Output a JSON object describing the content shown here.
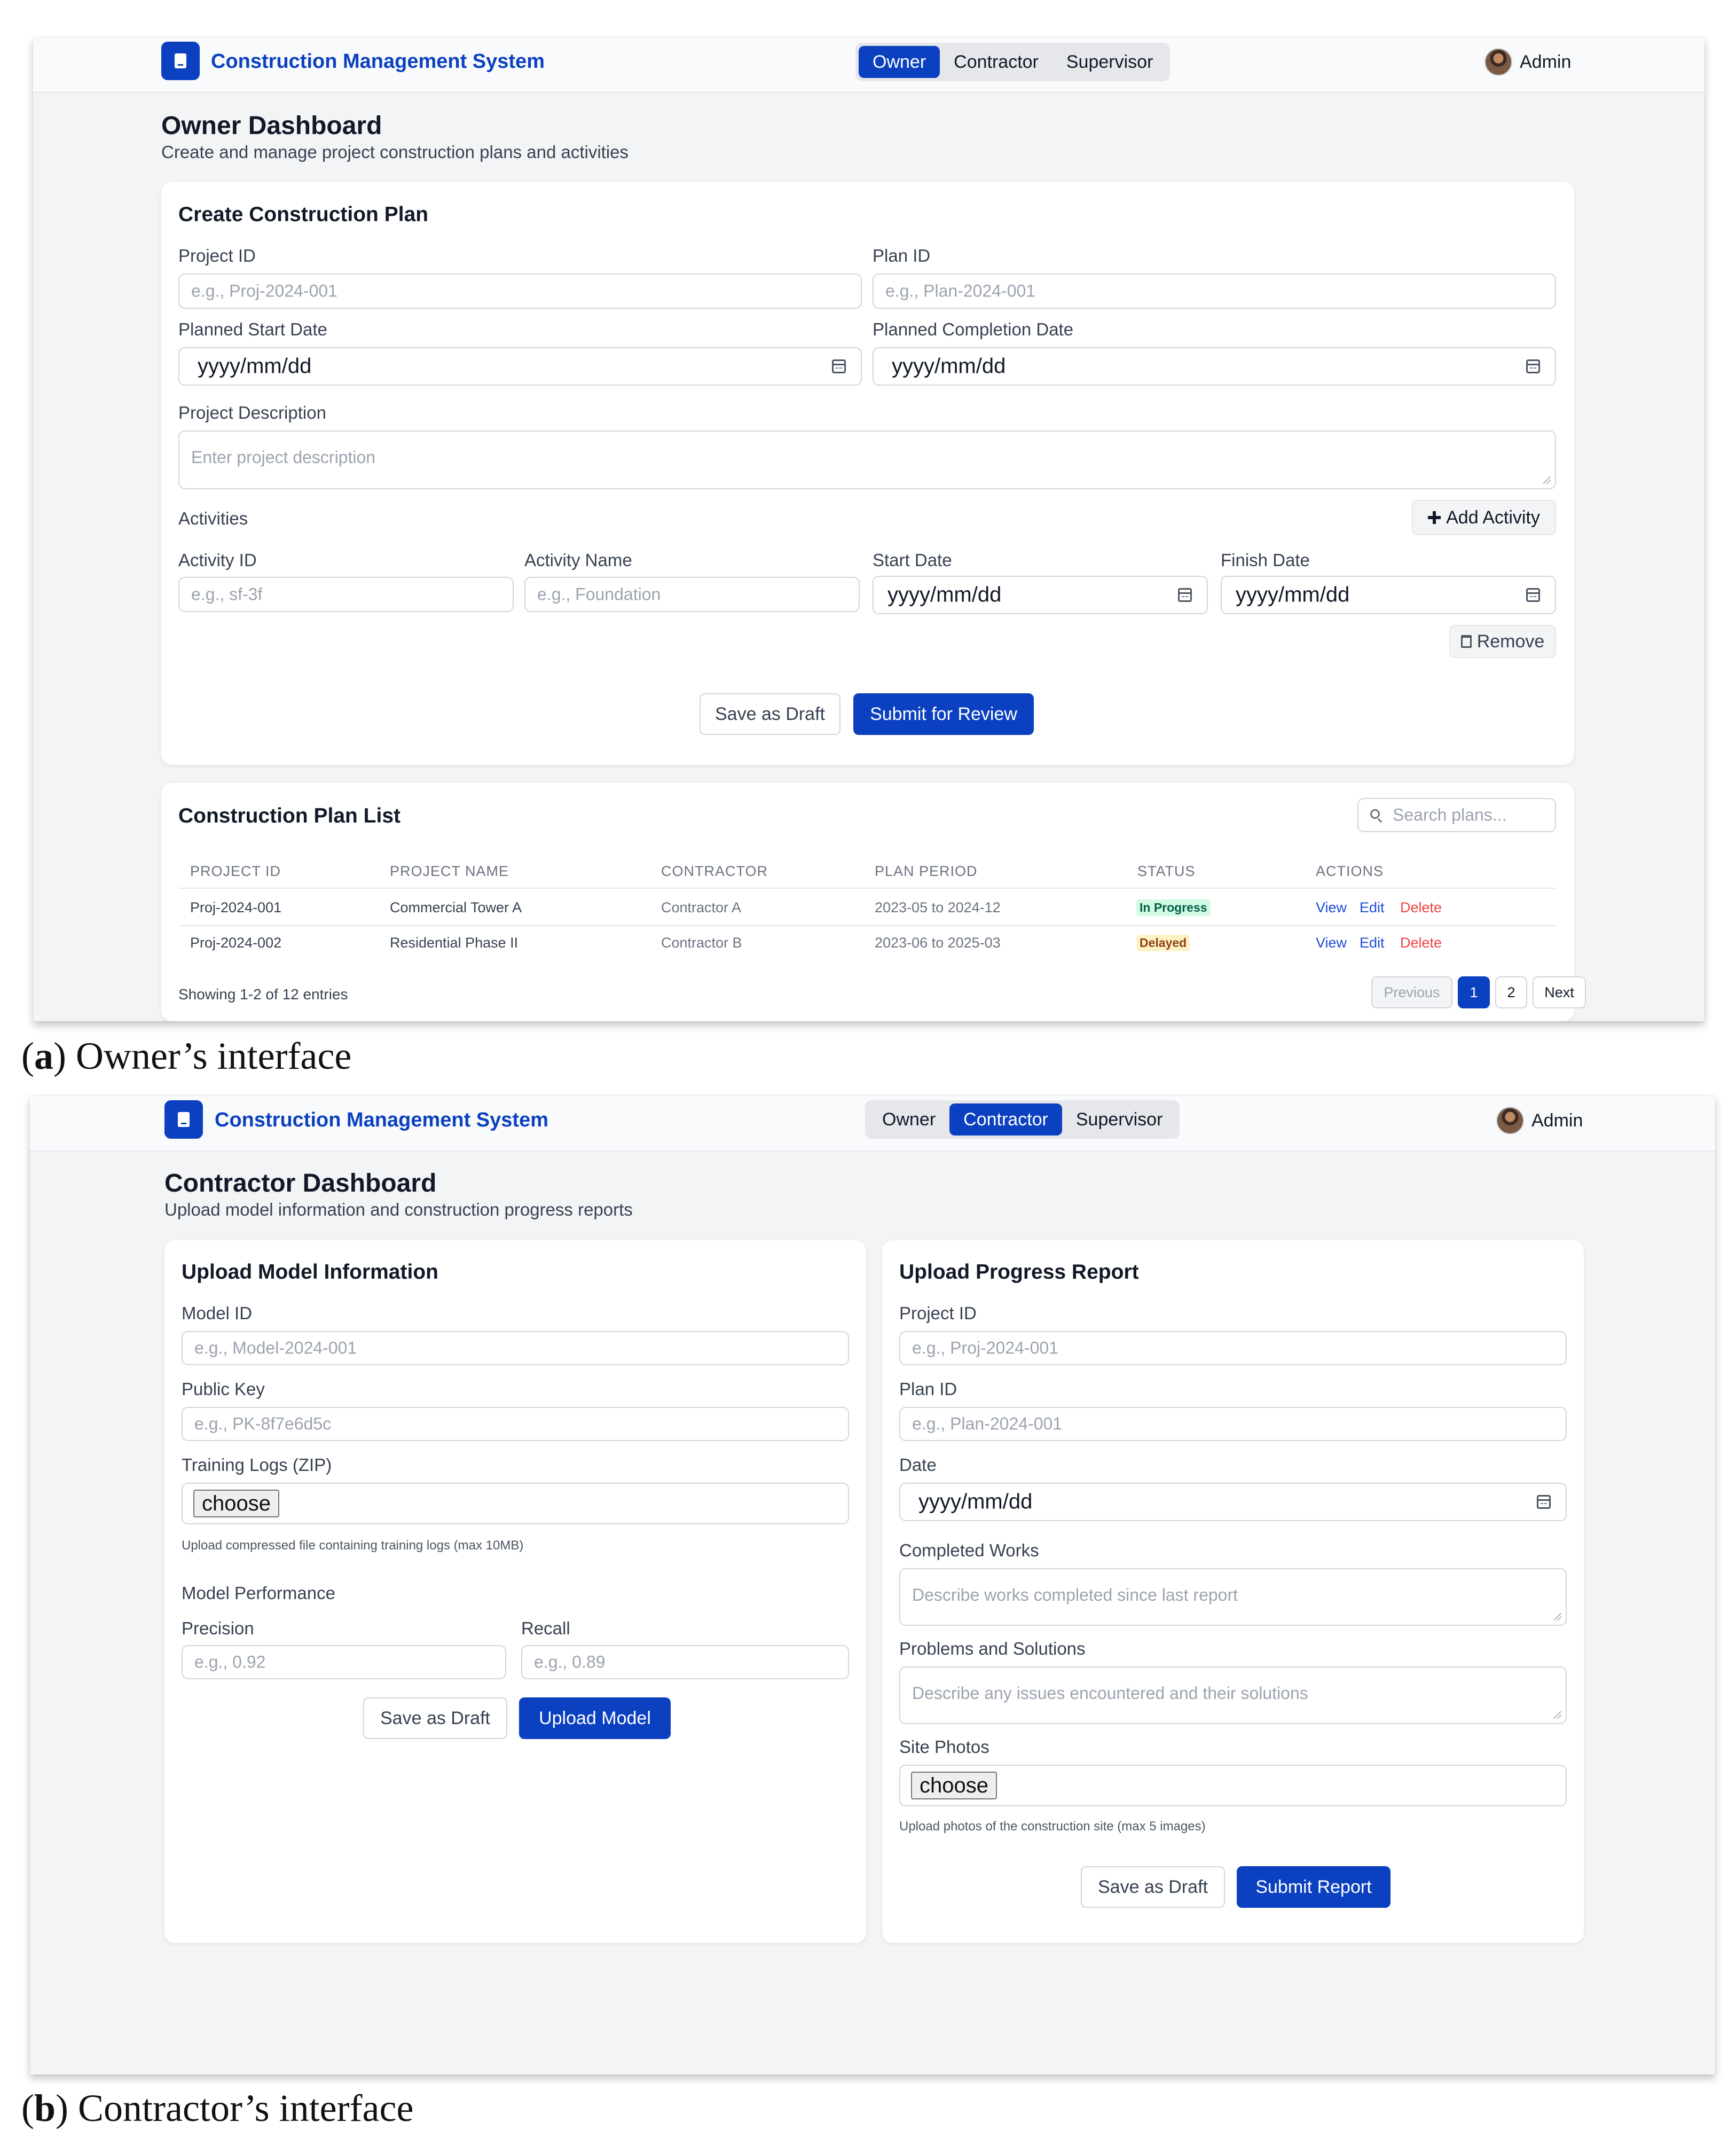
{
  "app": {
    "brand": "Construction Management System",
    "role_tabs": [
      "Owner",
      "Contractor",
      "Supervisor"
    ],
    "user": "Admin",
    "accent_color": "#0b40c0"
  },
  "owner": {
    "page_title": "Owner Dashboard",
    "page_subtitle": "Create and manage project construction plans and activities",
    "create_plan": {
      "title": "Create Construction Plan",
      "project_id_label": "Project ID",
      "project_id_placeholder": "e.g., Proj-2024-001",
      "plan_id_label": "Plan ID",
      "plan_id_placeholder": "e.g., Plan-2024-001",
      "start_date_label": "Planned Start Date",
      "completion_date_label": "Planned Completion Date",
      "date_placeholder": "yyyy/mm/dd",
      "description_label": "Project Description",
      "description_placeholder": "Enter project description",
      "activities_label": "Activities",
      "add_activity": "Add Activity",
      "activity_id_label": "Activity ID",
      "activity_id_placeholder": "e.g., sf-3f",
      "activity_name_label": "Activity Name",
      "activity_name_placeholder": "e.g., Foundation",
      "activity_start_label": "Start Date",
      "activity_finish_label": "Finish Date",
      "remove": "Remove",
      "save_draft": "Save as Draft",
      "submit": "Submit for Review"
    },
    "plan_list": {
      "title": "Construction Plan List",
      "search_placeholder": "Search plans...",
      "columns": [
        "PROJECT ID",
        "PROJECT NAME",
        "CONTRACTOR",
        "PLAN PERIOD",
        "STATUS",
        "ACTIONS"
      ],
      "rows": [
        {
          "project_id": "Proj-2024-001",
          "name": "Commercial Tower A",
          "contractor": "Contractor A",
          "period": "2023-05 to 2024-12",
          "status": "In Progress",
          "status_color": "green"
        },
        {
          "project_id": "Proj-2024-002",
          "name": "Residential Phase II",
          "contractor": "Contractor B",
          "period": "2023-06 to 2025-03",
          "status": "Delayed",
          "status_color": "yellow"
        }
      ],
      "actions": [
        "View",
        "Edit",
        "Delete"
      ],
      "showing": "Showing 1-2 of 12 entries",
      "pagination": {
        "previous": "Previous",
        "pages": [
          "1",
          "2"
        ],
        "current": "1",
        "next": "Next"
      }
    }
  },
  "contractor": {
    "page_title": "Contractor Dashboard",
    "page_subtitle": "Upload model information and construction progress reports",
    "model": {
      "title": "Upload Model Information",
      "model_id_label": "Model ID",
      "model_id_placeholder": "e.g., Model-2024-001",
      "public_key_label": "Public Key",
      "public_key_placeholder": "e.g., PK-8f7e6d5c",
      "logs_label": "Training Logs (ZIP)",
      "choose": "choose",
      "logs_hint": "Upload compressed file containing training logs (max 10MB)",
      "performance_label": "Model Performance",
      "precision_label": "Precision",
      "precision_placeholder": "e.g., 0.92",
      "recall_label": "Recall",
      "recall_placeholder": "e.g., 0.89",
      "save_draft": "Save as Draft",
      "upload": "Upload Model"
    },
    "report": {
      "title": "Upload Progress Report",
      "project_id_label": "Project ID",
      "project_id_placeholder": "e.g., Proj-2024-001",
      "plan_id_label": "Plan ID",
      "plan_id_placeholder": "e.g., Plan-2024-001",
      "date_label": "Date",
      "date_placeholder": "yyyy/mm/dd",
      "completed_label": "Completed Works",
      "completed_placeholder": "Describe works completed since last report",
      "problems_label": "Problems and Solutions",
      "problems_placeholder": "Describe any issues encountered and their solutions",
      "photos_label": "Site Photos",
      "choose": "choose",
      "photos_hint": "Upload photos of the construction site (max 5 images)",
      "save_draft": "Save as Draft",
      "submit": "Submit Report"
    }
  },
  "captions": {
    "a_letter": "a",
    "a_text": "Owner’s interface",
    "b_letter": "b",
    "b_text": "Contractor’s interface"
  }
}
